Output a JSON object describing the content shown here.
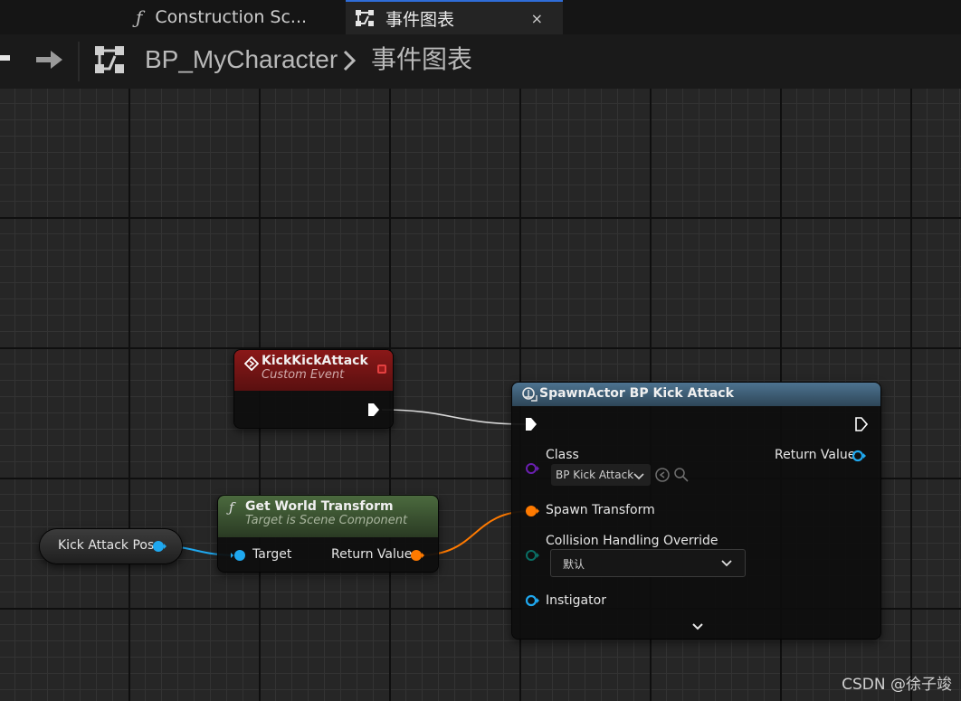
{
  "tabs": [
    {
      "label": "Construction Sc...",
      "icon": "function-icon",
      "active": false
    },
    {
      "label": "事件图表",
      "icon": "event-graph-icon",
      "active": true,
      "close": "×"
    }
  ],
  "breadcrumb": {
    "items": [
      "BP_MyCharacter",
      "事件图表"
    ]
  },
  "nodes": {
    "custom_event": {
      "title": "KickKickAttack",
      "subtitle": "Custom Event",
      "header_color": "#8a1818"
    },
    "get_world_transform": {
      "title": "Get World Transform",
      "subtitle": "Target is Scene Component",
      "header_color": "#4b6a3e",
      "inputs": [
        "Target"
      ],
      "outputs": [
        "Return Value"
      ]
    },
    "variable": {
      "title": "Kick Attack Pos"
    },
    "spawn_actor": {
      "title": "SpawnActor BP Kick Attack",
      "header_color": "#4d7390",
      "class_label": "Class",
      "class_value": "BP Kick Attack",
      "return_label": "Return Value",
      "spawn_transform_label": "Spawn Transform",
      "collision_label": "Collision Handling Override",
      "collision_value": "默认",
      "instigator_label": "Instigator"
    }
  },
  "pin_colors": {
    "exec": "#ffffff",
    "object": "#1fa8ef",
    "transform": "#ff7a00",
    "class": "#6a1fb0",
    "enum": "#0a6e64"
  },
  "watermark": "CSDN @徐子竣"
}
